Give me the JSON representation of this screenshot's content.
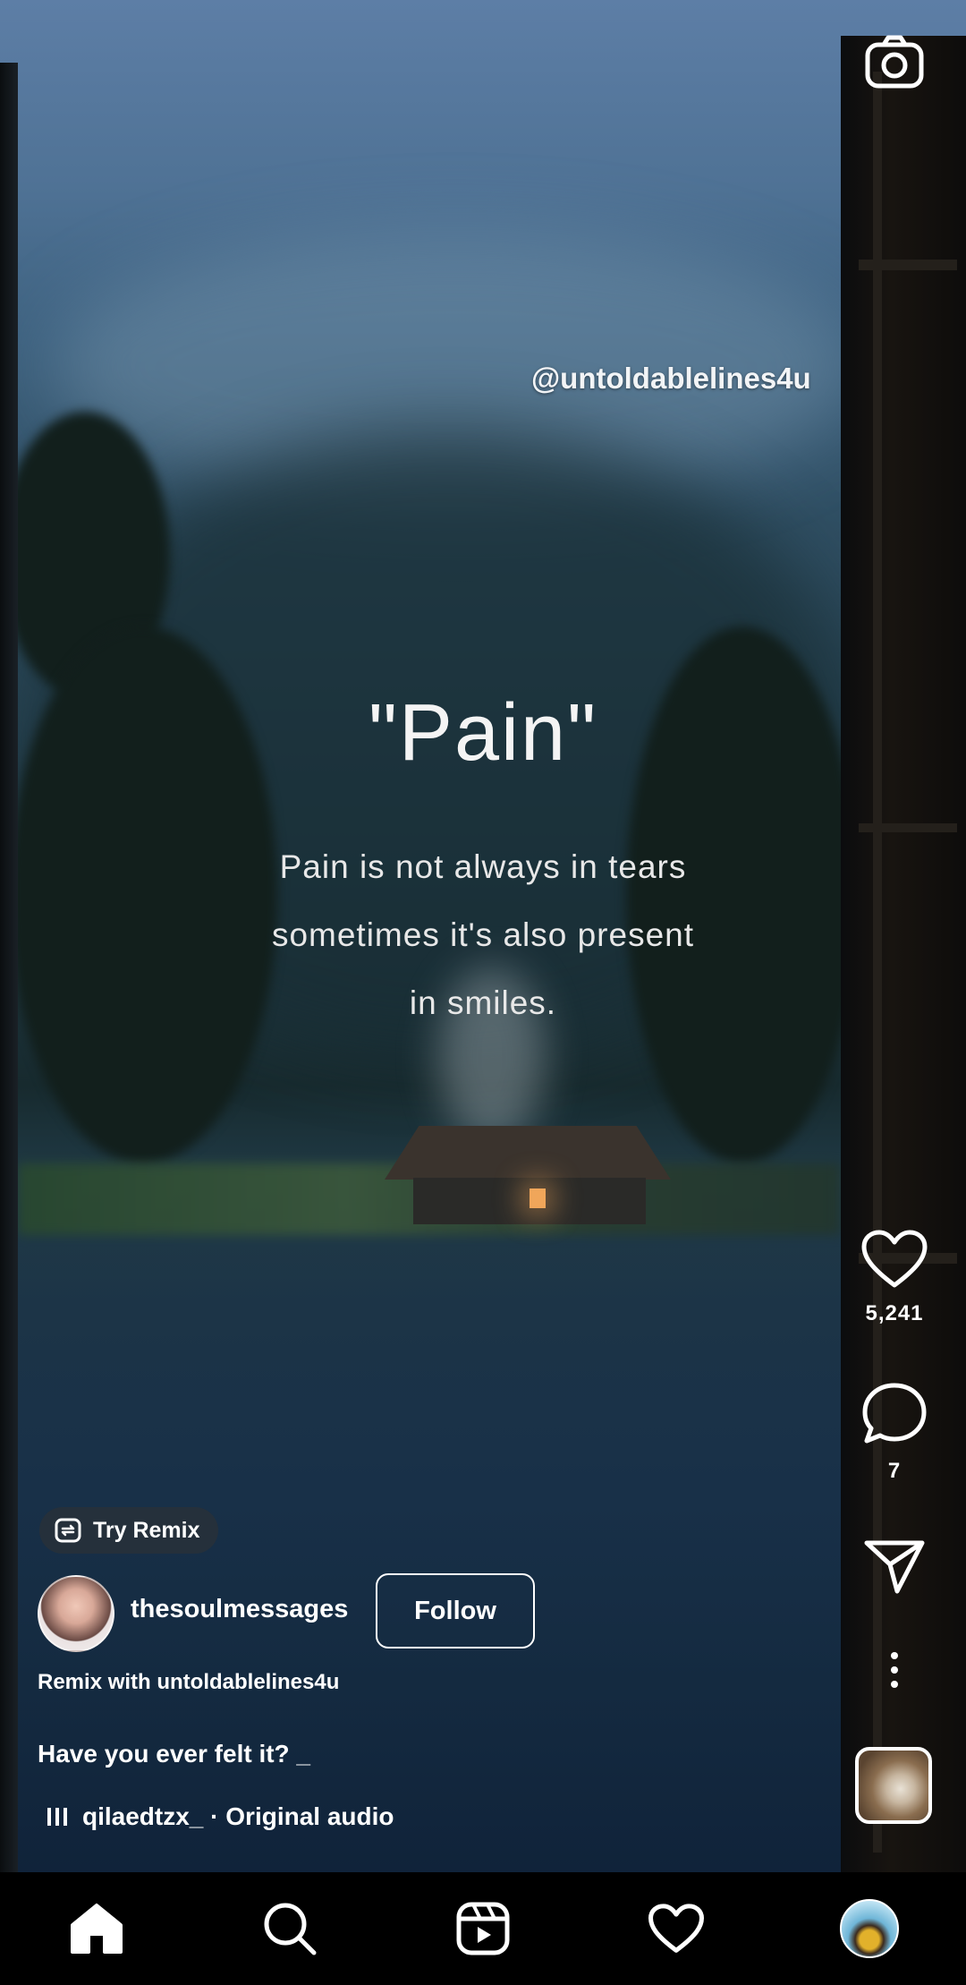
{
  "overlay": {
    "watermark": "@untoldablelines4u",
    "quote_title": "\"Pain\"",
    "quote_lines": [
      "Pain is not always in tears",
      "sometimes it's also present",
      "in smiles."
    ]
  },
  "actions": {
    "likes": "5,241",
    "comments": "7"
  },
  "post": {
    "remix_label": "Try Remix",
    "username": "thesoulmessages",
    "follow_label": "Follow",
    "remix_with": "Remix with untoldablelines4u",
    "caption": "Have you ever felt it? _",
    "audio": "qilaedtzx_ · Original audio"
  },
  "icons": {
    "top": "camera-icon",
    "side": [
      "heart-icon",
      "comment-icon",
      "share-icon",
      "more-icon"
    ],
    "nav": [
      "home-icon",
      "search-icon",
      "reels-icon",
      "heart-icon",
      "profile-avatar"
    ]
  }
}
